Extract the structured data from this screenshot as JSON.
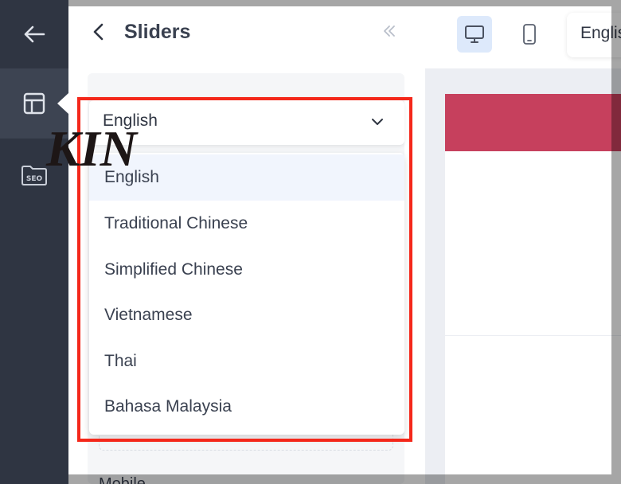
{
  "panel": {
    "title": "Sliders"
  },
  "language_select": {
    "value": "English",
    "options": [
      "English",
      "Traditional Chinese",
      "Simplified Chinese",
      "Vietnamese",
      "Thai",
      "Bahasa Malaysia"
    ]
  },
  "sections": {
    "mobile_label": "Mobile"
  },
  "toolbar": {
    "language": "English",
    "active_device": "desktop"
  },
  "preview": {
    "brand_text": "KIN"
  },
  "sidebar": {
    "items": [
      {
        "icon": "arrow-left-icon"
      },
      {
        "icon": "layout-icon",
        "active": true
      },
      {
        "icon": "seo-folder-icon"
      }
    ]
  },
  "colors": {
    "rail": "#2f3542",
    "highlight": "#f4271a",
    "banner": "#c6405d",
    "active_item": "#f1f5fd"
  }
}
